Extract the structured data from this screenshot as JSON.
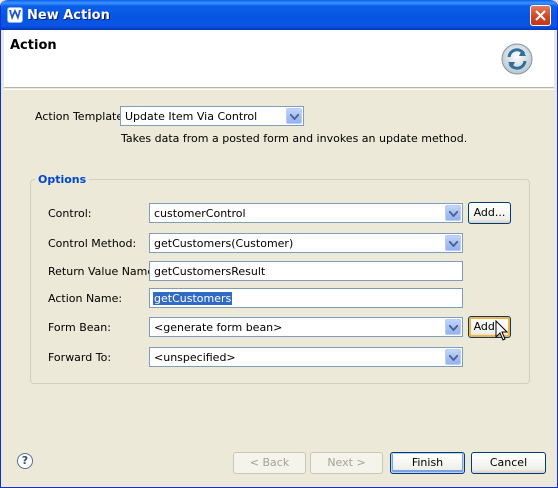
{
  "window": {
    "title": "New Action"
  },
  "banner": {
    "title": "Action",
    "icon": "refresh-arrows-icon"
  },
  "template": {
    "label": "Action Template:",
    "value": "Update Item Via Control",
    "description": "Takes data from a posted form and invokes an update method."
  },
  "options": {
    "title": "Options",
    "control": {
      "label": "Control:",
      "value": "customerControl",
      "add_label": "Add..."
    },
    "control_method": {
      "label": "Control Method:",
      "value": "getCustomers(Customer)"
    },
    "return_value_name": {
      "label": "Return Value Name:",
      "value": "getCustomersResult"
    },
    "action_name": {
      "label": "Action Name:",
      "value": "getCustomers"
    },
    "form_bean": {
      "label": "Form Bean:",
      "value": "<generate form bean>",
      "add_label": "Add..."
    },
    "forward_to": {
      "label": "Forward To:",
      "value": "<unspecified>"
    }
  },
  "footer": {
    "help": "?",
    "back_label": "< Back",
    "next_label": "Next >",
    "finish_label": "Finish",
    "cancel_label": "Cancel"
  },
  "colors": {
    "titlebar": "#0754e2",
    "accent": "#0046d5",
    "selection": "#316ac5"
  }
}
